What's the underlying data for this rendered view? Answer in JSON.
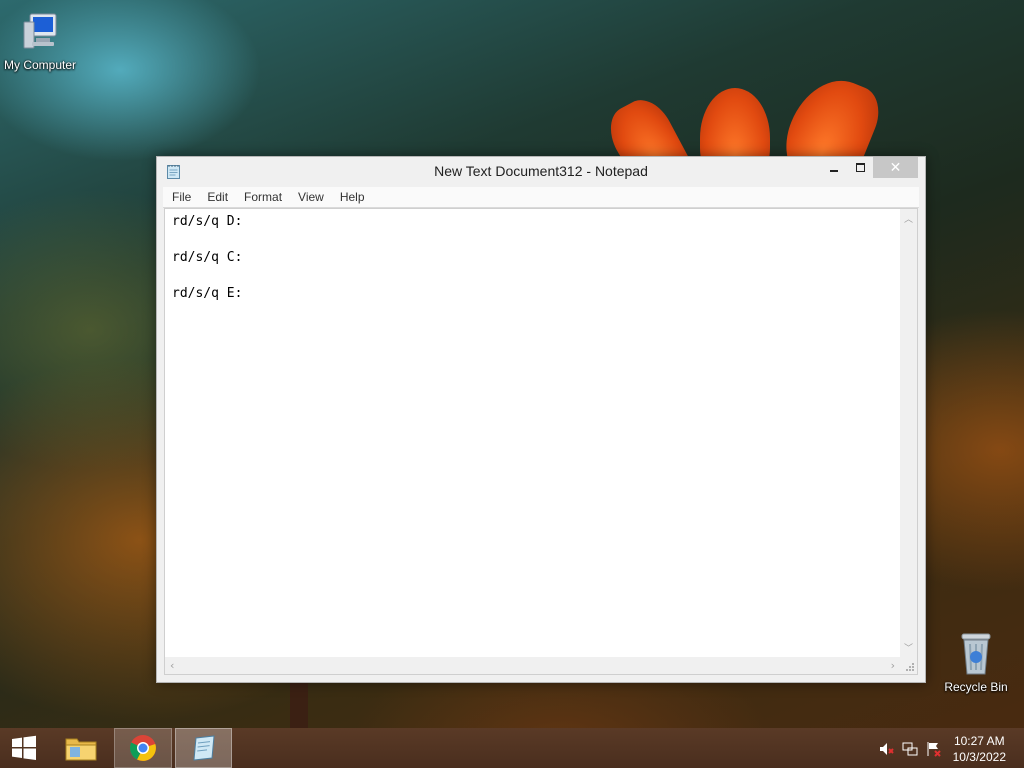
{
  "desktop": {
    "icons": [
      {
        "label": "My Computer",
        "icon": "computer-icon"
      },
      {
        "label": "Recycle Bin",
        "icon": "recycle-bin-icon"
      }
    ]
  },
  "window": {
    "title": "New Text Document312 - Notepad",
    "app_icon": "notepad-icon",
    "close_glyph": "✕",
    "menu": [
      "File",
      "Edit",
      "Format",
      "View",
      "Help"
    ],
    "lines": [
      "rd/s/q D:",
      "",
      "rd/s/q C:",
      "",
      "rd/s/q E:"
    ]
  },
  "taskbar": {
    "pinned": [
      {
        "name": "start-button",
        "icon": "windows-logo-icon"
      },
      {
        "name": "file-explorer",
        "icon": "folder-icon"
      },
      {
        "name": "chrome",
        "icon": "chrome-icon"
      },
      {
        "name": "notepad",
        "icon": "notepad-icon"
      }
    ],
    "tray": {
      "icons": [
        "volume-muted-icon",
        "network-icon",
        "action-center-flag-icon"
      ],
      "time": "10:27 AM",
      "date": "10/3/2022"
    }
  },
  "colors": {
    "close_button": "#c7c7c7",
    "taskbar": "#4f3221",
    "accent_orange": "#e14a10"
  }
}
